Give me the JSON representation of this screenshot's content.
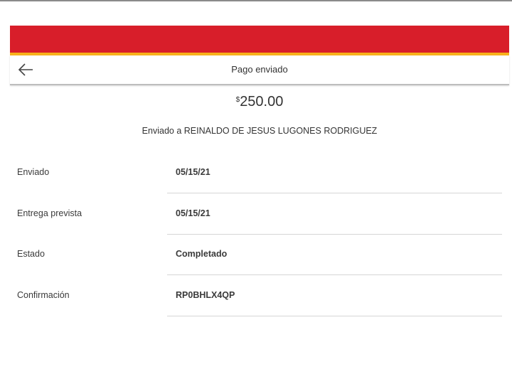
{
  "header": {
    "title": "Pago enviado",
    "back_icon": "arrow-left-icon"
  },
  "colors": {
    "brand_red": "#d81e2a",
    "brand_yellow": "#f8b21c"
  },
  "payment": {
    "currency_symbol": "$",
    "amount": "250.00",
    "recipient_text": "Enviado a REINALDO DE JESUS LUGONES RODRIGUEZ"
  },
  "details": [
    {
      "label": "Enviado",
      "value": "05/15/21"
    },
    {
      "label": "Entrega prevista",
      "value": "05/15/21"
    },
    {
      "label": "Estado",
      "value": "Completado"
    },
    {
      "label": "Confirmación",
      "value": "RP0BHLX4QP"
    }
  ]
}
